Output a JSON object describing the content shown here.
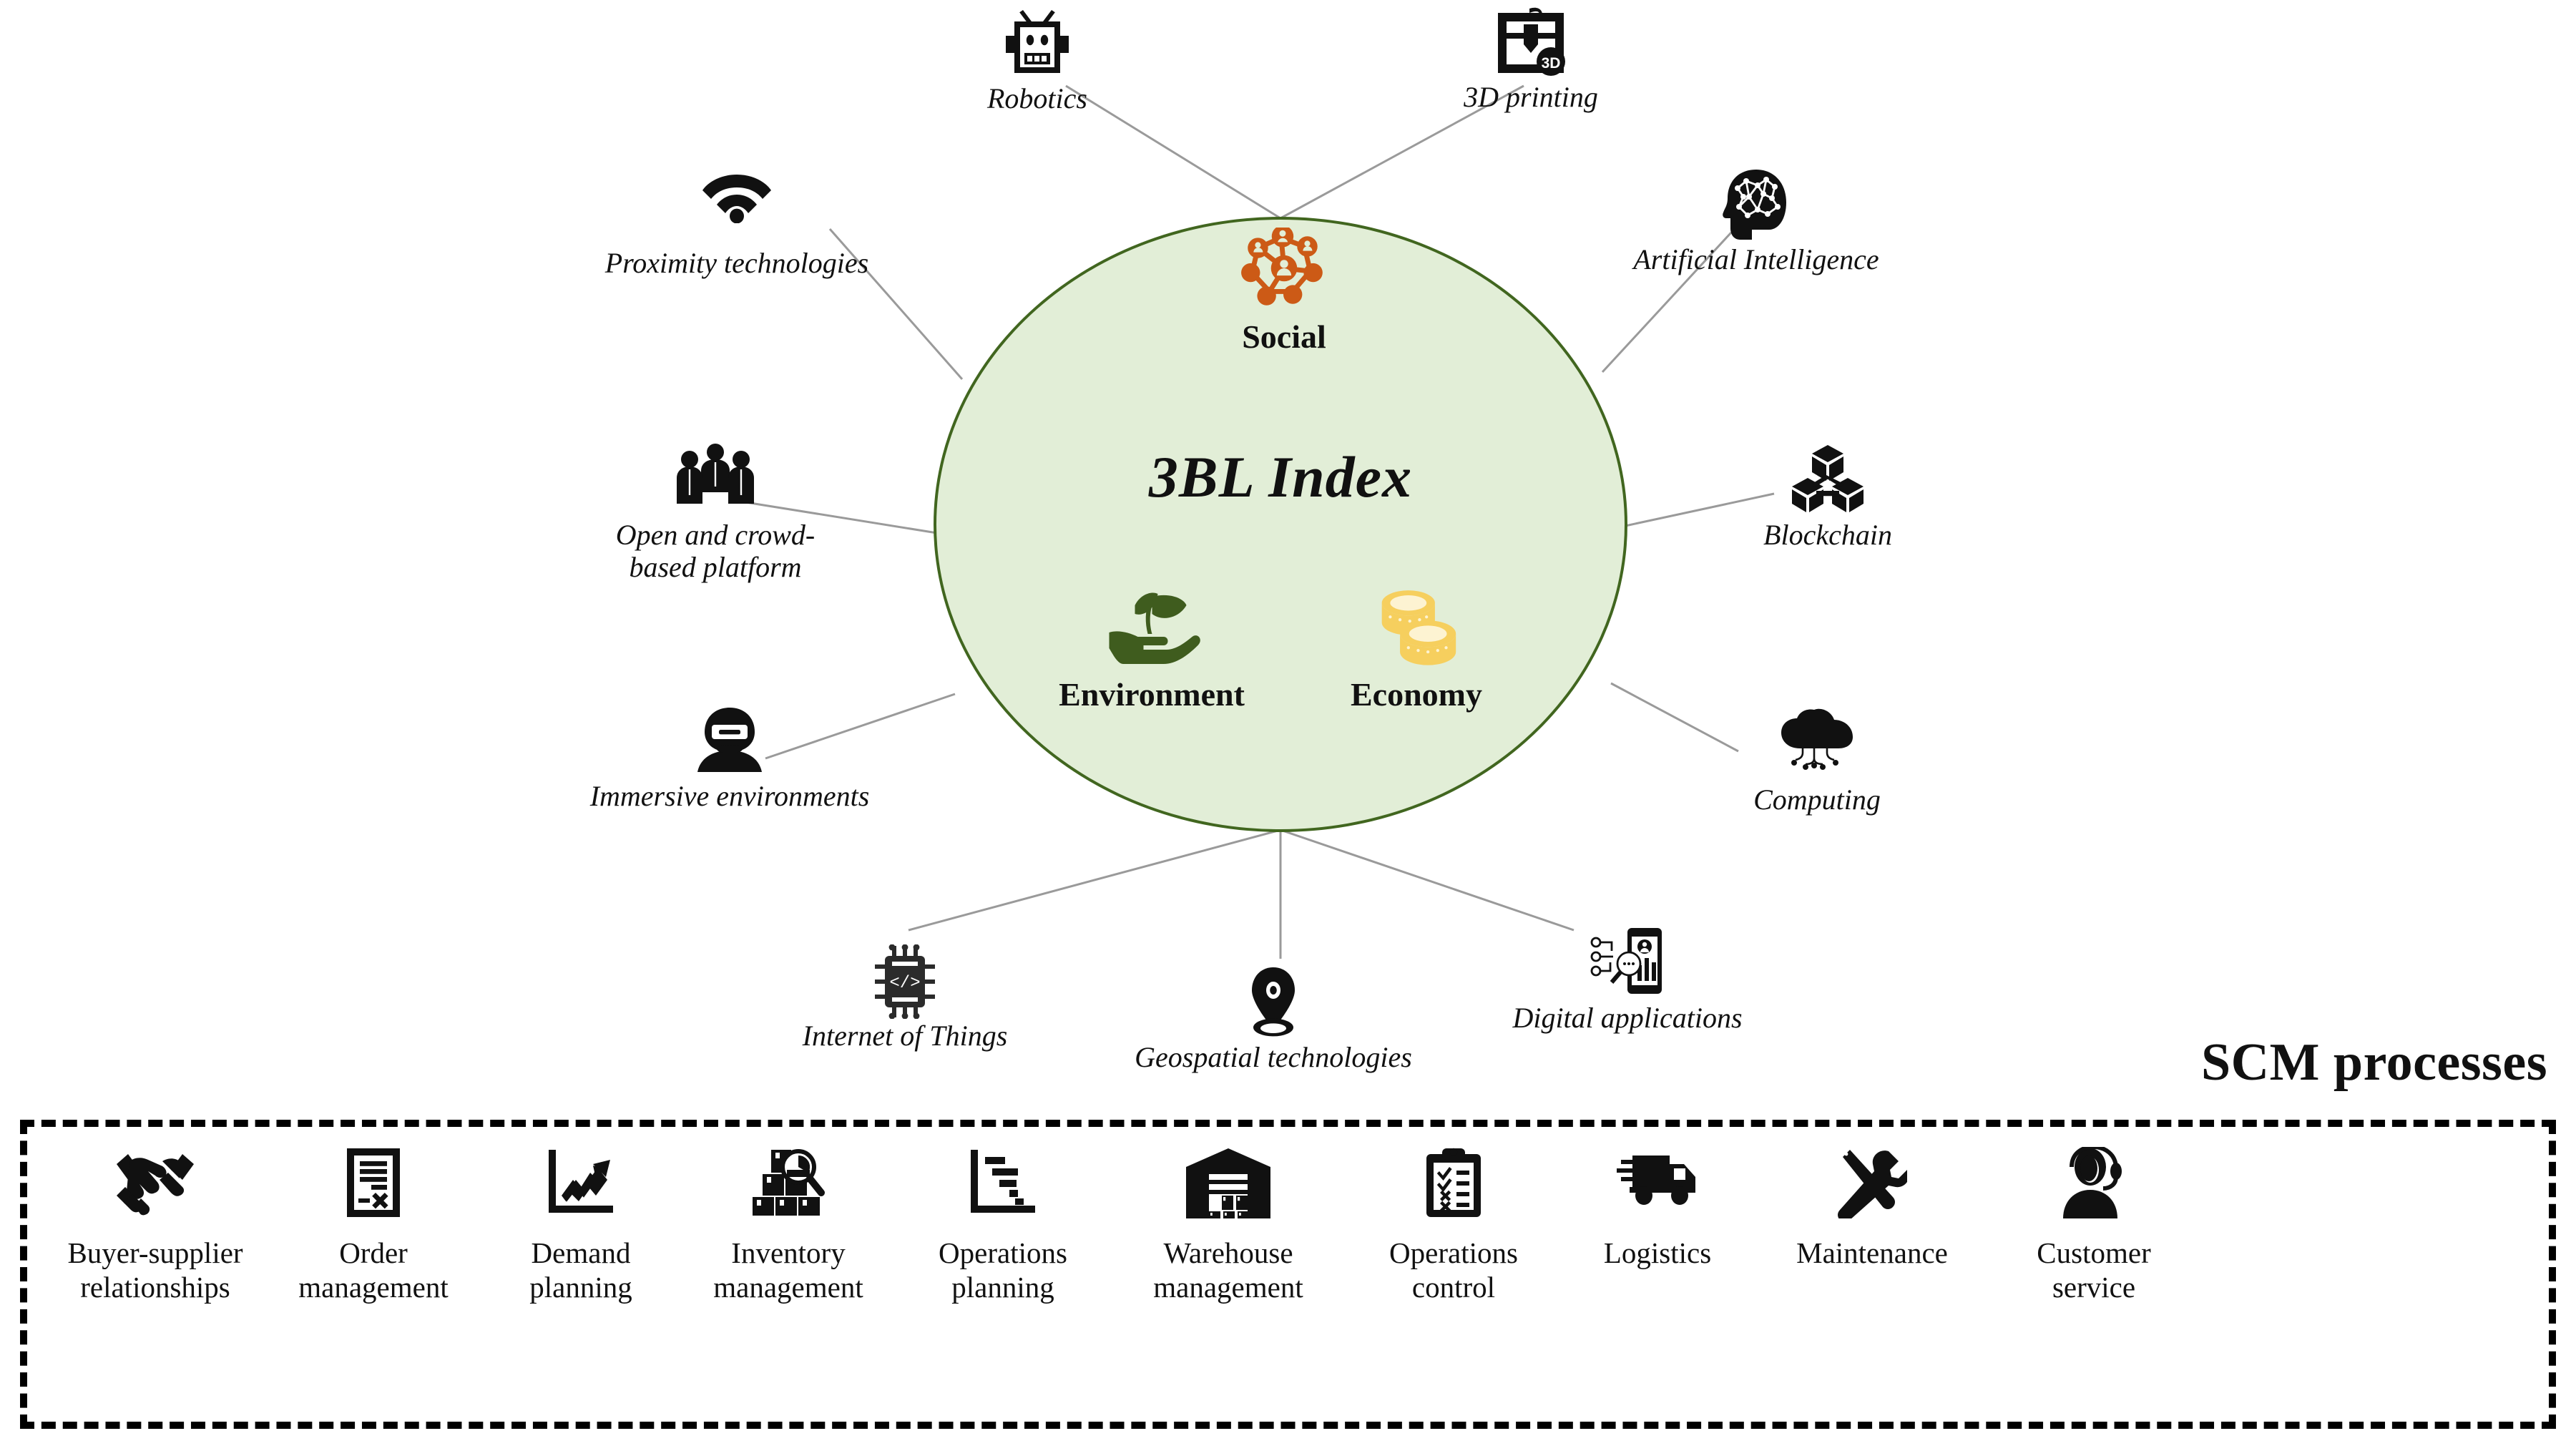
{
  "core": {
    "title": "3BL Index",
    "fill_color": "#e2eed7",
    "border_color": "#41661f",
    "pillars": [
      {
        "id": "social",
        "label": "Social",
        "icon": "social-network-icon",
        "color": "#cc5a16"
      },
      {
        "id": "environment",
        "label": "Environment",
        "icon": "plant-in-hand-icon",
        "color": "#3f5c1e"
      },
      {
        "id": "economy",
        "label": "Economy",
        "icon": "coins-stack-icon",
        "color": "#f6cf5e"
      }
    ]
  },
  "technologies": [
    {
      "id": "robotics",
      "label": "Robotics",
      "icon": "robot-icon"
    },
    {
      "id": "3dprinting",
      "label": "3D printing",
      "icon": "3d-printer-icon"
    },
    {
      "id": "proximity",
      "label": "Proximity technologies",
      "icon": "wifi-icon"
    },
    {
      "id": "ai",
      "label": "Artificial Intelligence",
      "icon": "brain-head-icon"
    },
    {
      "id": "openplatform",
      "label": "Open and crowd-based platform",
      "icon": "people-group-icon"
    },
    {
      "id": "blockchain",
      "label": "Blockchain",
      "icon": "blockchain-cubes-icon"
    },
    {
      "id": "immersive",
      "label": "Immersive environments",
      "icon": "vr-headset-icon"
    },
    {
      "id": "computing",
      "label": "Computing",
      "icon": "cloud-computing-icon"
    },
    {
      "id": "iot",
      "label": "Internet of Things",
      "icon": "microchip-icon"
    },
    {
      "id": "geospatial",
      "label": "Geospatial technologies",
      "icon": "map-pin-icon"
    },
    {
      "id": "digitalapps",
      "label": "Digital applications",
      "icon": "mobile-analytics-icon"
    }
  ],
  "tech_labels": {
    "openplatform_line1": "Open and crowd-",
    "openplatform_line2": "based platform"
  },
  "scm": {
    "title": "SCM processes",
    "items": [
      {
        "id": "buyer-supplier-relationships",
        "line1": "Buyer-supplier",
        "line2": "relationships",
        "icon": "handshake-icon"
      },
      {
        "id": "order-management",
        "line1": "Order",
        "line2": "management",
        "icon": "order-document-icon"
      },
      {
        "id": "demand-planning",
        "line1": "Demand",
        "line2": "planning",
        "icon": "trend-chart-icon"
      },
      {
        "id": "inventory-management",
        "line1": "Inventory",
        "line2": "management",
        "icon": "boxes-magnifier-icon"
      },
      {
        "id": "operations-planning",
        "line1": "Operations",
        "line2": "planning",
        "icon": "gantt-chart-icon"
      },
      {
        "id": "warehouse-management",
        "line1": "Warehouse",
        "line2": "management",
        "icon": "warehouse-icon"
      },
      {
        "id": "operations-control",
        "line1": "Operations",
        "line2": "control",
        "icon": "clipboard-checklist-icon"
      },
      {
        "id": "logistics",
        "line1": "Logistics",
        "line2": "",
        "icon": "delivery-truck-icon"
      },
      {
        "id": "maintenance",
        "line1": "Maintenance",
        "line2": "",
        "icon": "tools-icon"
      },
      {
        "id": "customer-service",
        "line1": "Customer",
        "line2": "service",
        "icon": "headset-agent-icon"
      }
    ]
  },
  "colors": {
    "connector_line": "#9a9a9a",
    "dashed_border": "#000000",
    "social_accent": "#cc5a16",
    "environment_accent": "#3f5c1e",
    "economy_accent": "#f6cf5e",
    "core_fill": "#e2eed7",
    "core_stroke": "#41661f"
  }
}
